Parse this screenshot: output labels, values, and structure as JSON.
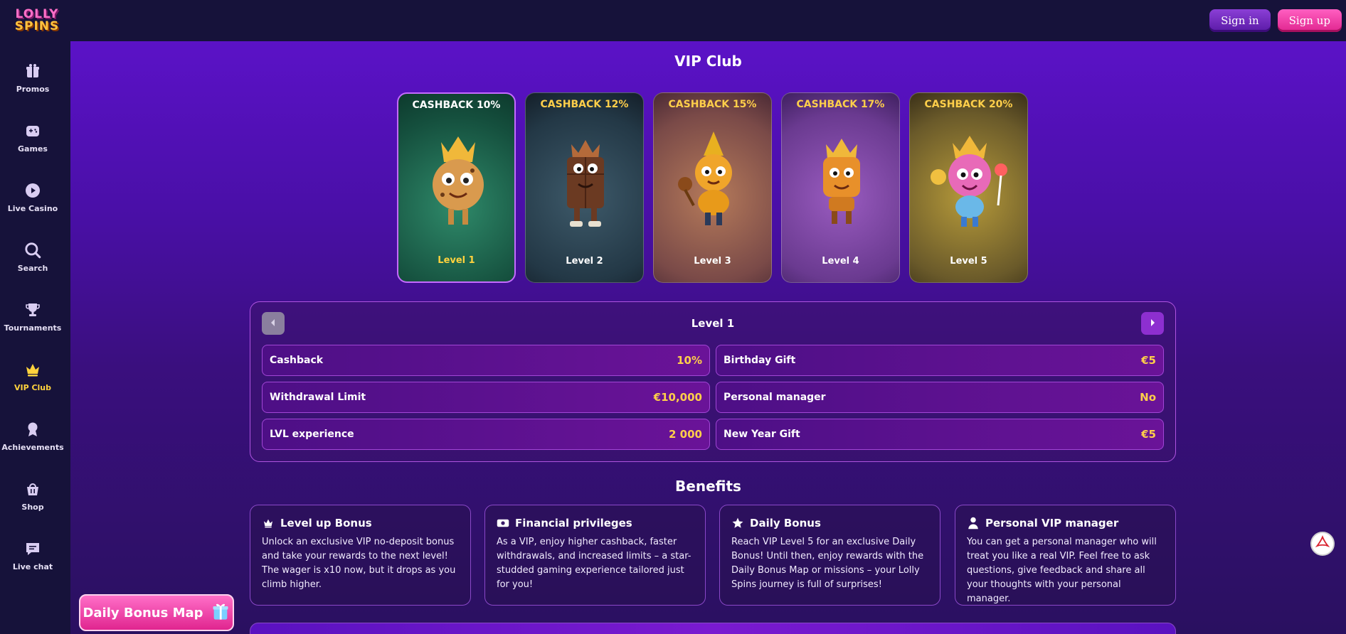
{
  "header": {
    "logo_line1": "LOLLY",
    "logo_line2": "SPINS",
    "signin_label": "Sign in",
    "signup_label": "Sign up"
  },
  "sidebar": {
    "items": [
      {
        "label": "Promos",
        "icon": "gift-icon"
      },
      {
        "label": "Games",
        "icon": "gamepad-icon"
      },
      {
        "label": "Live Casino",
        "icon": "play-icon"
      },
      {
        "label": "Search",
        "icon": "search-icon"
      },
      {
        "label": "Tournaments",
        "icon": "trophy-icon"
      },
      {
        "label": "VIP Club",
        "icon": "crown-icon",
        "active": true
      },
      {
        "label": "Achievements",
        "icon": "medal-icon"
      },
      {
        "label": "Shop",
        "icon": "basket-icon"
      },
      {
        "label": "Live chat",
        "icon": "chat-icon"
      }
    ]
  },
  "main": {
    "title": "VIP Club",
    "cards": [
      {
        "cashback": "CASHBACK 10%",
        "level": "Level 1",
        "active": true
      },
      {
        "cashback": "CASHBACK 12%",
        "level": "Level 2"
      },
      {
        "cashback": "CASHBACK 15%",
        "level": "Level 3"
      },
      {
        "cashback": "CASHBACK 17%",
        "level": "Level 4"
      },
      {
        "cashback": "CASHBACK 20%",
        "level": "Level 5"
      }
    ],
    "level_panel": {
      "title": "Level 1",
      "stats": [
        {
          "label": "Cashback",
          "value": "10%"
        },
        {
          "label": "Birthday Gift",
          "value": "€5"
        },
        {
          "label": "Withdrawal Limit",
          "value": "€10,000"
        },
        {
          "label": "Personal manager",
          "value": "No"
        },
        {
          "label": "LVL experience",
          "value": "2 000"
        },
        {
          "label": "New Year Gift",
          "value": "€5"
        }
      ]
    },
    "benefits_title": "Benefits",
    "benefits": [
      {
        "title": "Level up Bonus",
        "icon": "crown-icon",
        "text": "Unlock an exclusive VIP no-deposit bonus and take your rewards to the next level! The wager is x10 now, but it drops as you climb higher."
      },
      {
        "title": "Financial privileges",
        "icon": "cash-icon",
        "text": "As a VIP, enjoy higher cashback, faster withdrawals, and increased limits – a star-studded gaming experience tailored just for you!"
      },
      {
        "title": "Daily Bonus",
        "icon": "star-icon",
        "text": "Reach VIP Level 5 for an exclusive Daily Bonus! Until then, enjoy rewards with the Daily Bonus Map or missions – your Lolly Spins journey is full of surprises!"
      },
      {
        "title": "Personal VIP manager",
        "icon": "user-icon",
        "text": "You can get a personal manager who will treat you like a real VIP. Feel free to ask questions, give feedback and share all your thoughts with your personal manager."
      }
    ]
  },
  "daily_bonus_button": "Daily Bonus Map",
  "colors": {
    "accent_gold": "#ffcf4a",
    "pink": "#ff5fc1",
    "purple": "#5b12c7"
  }
}
